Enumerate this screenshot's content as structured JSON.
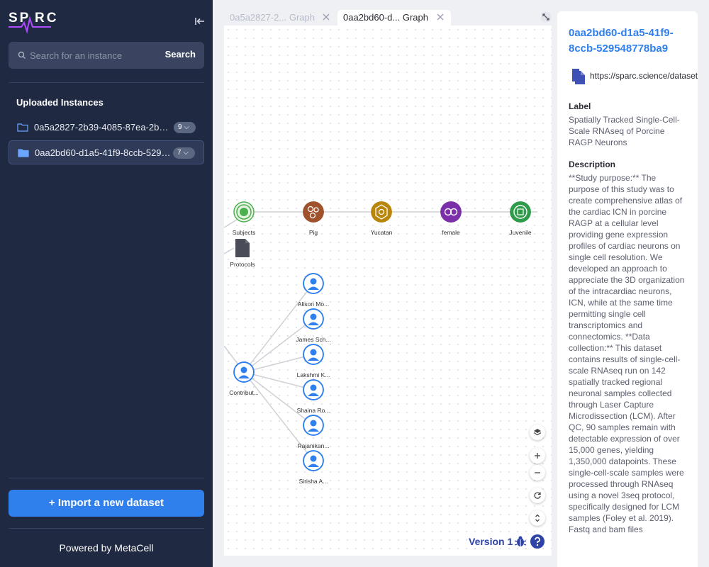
{
  "sidebar": {
    "logo_text": "SPARC",
    "search": {
      "placeholder": "Search for an instance",
      "button": "Search"
    },
    "uploaded_title": "Uploaded Instances",
    "instances": [
      {
        "name": "0a5a2827-2b39-4085-87ea-2b…",
        "count": "9"
      },
      {
        "name": "0aa2bd60-d1a5-41f9-8ccb-529…",
        "count": "7"
      }
    ],
    "import_button": "+ Import a new dataset",
    "powered_by": "Powered by MetaCell"
  },
  "tabs": [
    {
      "label": "0a5a2827-2... Graph",
      "active": false
    },
    {
      "label": "0aa2bd60-d... Graph",
      "active": true
    }
  ],
  "graph": {
    "nodes": {
      "subjects": "Subjects",
      "pig": "Pig",
      "yucatan": "Yucatan",
      "female": "female",
      "juvenile": "Juvenile",
      "protocols": "Protocols",
      "contributors": "Contribut...",
      "c1": "Alison Mo...",
      "c2": "James Sch...",
      "c3": "Lakshmi K...",
      "c4": "Shaina Ro...",
      "c5": "Rajanikan...",
      "c6": "Sirisha A..."
    },
    "colors": {
      "subjects": "#4caf50",
      "pig": "#a0522d",
      "yucatan": "#b8860b",
      "female": "#7b2fa8",
      "juvenile": "#2e9b4a",
      "person": "#2f80ed",
      "protocols": "#4a4d57"
    },
    "version": "Version 1"
  },
  "panel": {
    "title": "0aa2bd60-d1a5-41f9-8ccb-529548778ba9",
    "url": "https://sparc.science/datasets",
    "label_heading": "Label",
    "label_value": "Spatially Tracked Single-Cell-Scale RNAseq of Porcine RAGP Neurons",
    "description_heading": "Description",
    "description_value": "**Study purpose:** The purpose of this study was to create comprehensive atlas of the cardiac ICN in porcine RAGP at a cellular level providing gene expression profiles of cardiac neurons on single cell resolution. We developed an approach to appreciate the 3D organization of the intracardiac neurons, ICN, while at the same time permitting single cell transcriptomics and connectomics. **Data collection:** This dataset contains results of single-cell-scale RNAseq run on 142 spatially tracked regional neuronal samples collected through Laser Capture Microdissection (LCM). After QC, 90 samples remain with detectable expression of over 15,000 genes, yielding 1,350,000 datapoints. These single-cell-scale samples were processed through RNAseq using a novel 3seq protocol, specifically designed for LCM samples (Foley et al. 2019). Fastq and bam files"
  }
}
